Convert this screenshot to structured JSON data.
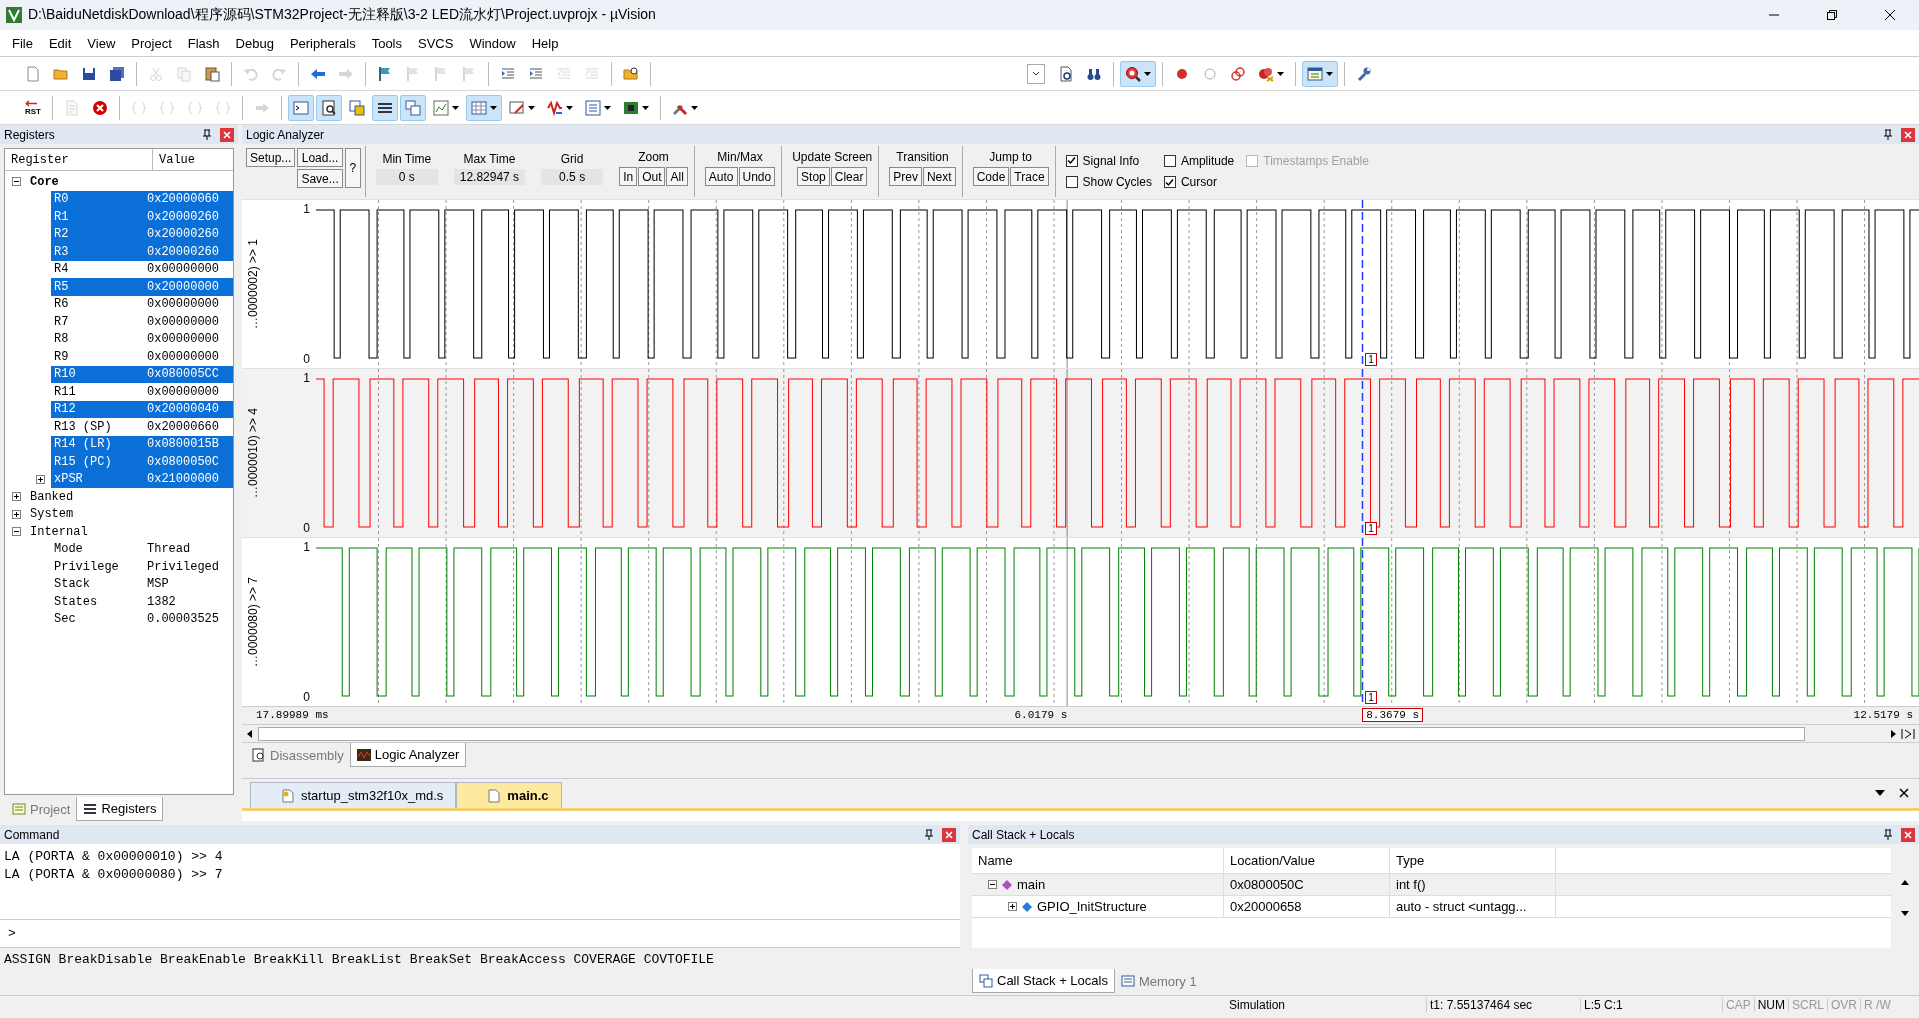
{
  "window": {
    "title": "D:\\BaiduNetdiskDownload\\程序源码\\STM32Project-无注释版\\3-2 LED流水灯\\Project.uvprojx - µVision"
  },
  "menu": [
    "File",
    "Edit",
    "View",
    "Project",
    "Flash",
    "Debug",
    "Peripherals",
    "Tools",
    "SVCS",
    "Window",
    "Help"
  ],
  "toolbars": [
    {
      "groups": [
        {
          "buttons": [
            {
              "kind": "new",
              "on": false,
              "disabled": false,
              "menu": false
            },
            {
              "kind": "open",
              "on": false,
              "disabled": false,
              "menu": false
            },
            {
              "kind": "save",
              "on": false,
              "disabled": false,
              "menu": false
            },
            {
              "kind": "saveall",
              "on": false,
              "disabled": false,
              "menu": false
            }
          ]
        },
        {
          "buttons": [
            {
              "kind": "cut",
              "on": false,
              "disabled": true,
              "menu": false
            },
            {
              "kind": "copy",
              "on": false,
              "disabled": true,
              "menu": false
            },
            {
              "kind": "paste",
              "on": false,
              "disabled": false,
              "menu": false
            }
          ]
        },
        {
          "buttons": [
            {
              "kind": "undo",
              "on": false,
              "disabled": true,
              "menu": false
            },
            {
              "kind": "redo",
              "on": false,
              "disabled": true,
              "menu": false
            }
          ]
        },
        {
          "buttons": [
            {
              "kind": "back",
              "on": false,
              "disabled": false,
              "menu": false
            },
            {
              "kind": "forward",
              "on": false,
              "disabled": true,
              "menu": false
            }
          ]
        },
        {
          "buttons": [
            {
              "kind": "flag",
              "on": false,
              "disabled": false,
              "menu": false
            },
            {
              "kind": "flag",
              "on": false,
              "disabled": true,
              "menu": false
            },
            {
              "kind": "flag",
              "on": false,
              "disabled": true,
              "menu": false
            },
            {
              "kind": "flag",
              "on": false,
              "disabled": true,
              "menu": false
            }
          ]
        },
        {
          "buttons": [
            {
              "kind": "indent",
              "on": false,
              "disabled": false,
              "menu": false
            },
            {
              "kind": "indent",
              "on": false,
              "disabled": false,
              "menu": false
            },
            {
              "kind": "comment",
              "on": false,
              "disabled": true,
              "menu": false
            },
            {
              "kind": "comment",
              "on": false,
              "disabled": true,
              "menu": false
            }
          ]
        },
        {
          "buttons": [
            {
              "kind": "findfiles",
              "on": false,
              "disabled": false,
              "menu": false
            }
          ]
        },
        {
          "buttons": [
            {
              "kind": "combo"
            },
            {
              "kind": "finddoc",
              "on": false,
              "disabled": false,
              "menu": false
            },
            {
              "kind": "binoculars",
              "on": false,
              "disabled": false,
              "menu": false
            }
          ]
        },
        {
          "buttons": [
            {
              "kind": "debug",
              "on": true,
              "disabled": false,
              "menu": true
            }
          ]
        },
        {
          "buttons": [
            {
              "kind": "breakpoint",
              "on": false,
              "disabled": false,
              "menu": false
            },
            {
              "kind": "circle",
              "on": false,
              "disabled": false,
              "menu": false
            },
            {
              "kind": "rings",
              "on": false,
              "disabled": false,
              "menu": false
            },
            {
              "kind": "killbp",
              "on": false,
              "disabled": false,
              "menu": true
            }
          ]
        },
        {
          "buttons": [
            {
              "kind": "window",
              "on": true,
              "disabled": false,
              "menu": true
            }
          ]
        },
        {
          "buttons": [
            {
              "kind": "wrench",
              "on": false,
              "disabled": false,
              "menu": false
            }
          ]
        }
      ]
    },
    {
      "groups": [
        {
          "buttons": [
            {
              "kind": "reset",
              "label": "RST",
              "on": false,
              "disabled": false,
              "menu": false
            }
          ]
        },
        {
          "buttons": [
            {
              "kind": "run",
              "on": false,
              "disabled": true,
              "menu": false
            },
            {
              "kind": "stop",
              "on": false,
              "disabled": false,
              "menu": false
            }
          ]
        },
        {
          "buttons": [
            {
              "kind": "braces",
              "on": false,
              "disabled": true,
              "menu": false
            },
            {
              "kind": "braces",
              "on": false,
              "disabled": true,
              "menu": false
            },
            {
              "kind": "braces",
              "on": false,
              "disabled": true,
              "menu": false
            },
            {
              "kind": "braces",
              "on": false,
              "disabled": true,
              "menu": false
            }
          ]
        },
        {
          "buttons": [
            {
              "kind": "arrow",
              "on": false,
              "disabled": true,
              "menu": false
            }
          ]
        },
        {
          "buttons": [
            {
              "kind": "command",
              "on": true,
              "disabled": false,
              "menu": false
            },
            {
              "kind": "disasm",
              "on": true,
              "disabled": false,
              "menu": false
            },
            {
              "kind": "symbols",
              "on": false,
              "disabled": false,
              "menu": false
            },
            {
              "kind": "registers",
              "on": true,
              "disabled": false,
              "menu": false
            },
            {
              "kind": "callstack",
              "on": true,
              "disabled": false,
              "menu": false
            },
            {
              "kind": "watch",
              "on": false,
              "disabled": false,
              "menu": true
            },
            {
              "kind": "grid",
              "on": true,
              "disabled": false,
              "menu": true
            },
            {
              "kind": "serial",
              "on": false,
              "disabled": false,
              "menu": true
            },
            {
              "kind": "analysis",
              "on": false,
              "disabled": false,
              "menu": true
            },
            {
              "kind": "trace",
              "on": false,
              "disabled": false,
              "menu": true
            },
            {
              "kind": "board",
              "on": false,
              "disabled": false,
              "menu": true
            }
          ]
        },
        {
          "buttons": [
            {
              "kind": "tools",
              "on": false,
              "disabled": false,
              "menu": true
            }
          ]
        }
      ]
    }
  ],
  "registers": {
    "title": "Registers",
    "columns": [
      "Register",
      "Value"
    ],
    "tree": [
      {
        "name": "Core",
        "bold": true,
        "expanded": true,
        "children": [
          {
            "name": "R0",
            "value": "0x20000060",
            "selected": true
          },
          {
            "name": "R1",
            "value": "0x20000260",
            "selected": true
          },
          {
            "name": "R2",
            "value": "0x20000260",
            "selected": true
          },
          {
            "name": "R3",
            "value": "0x20000260",
            "selected": true
          },
          {
            "name": "R4",
            "value": "0x00000000",
            "selected": false
          },
          {
            "name": "R5",
            "value": "0x20000000",
            "selected": true
          },
          {
            "name": "R6",
            "value": "0x00000000",
            "selected": false
          },
          {
            "name": "R7",
            "value": "0x00000000",
            "selected": false
          },
          {
            "name": "R8",
            "value": "0x00000000",
            "selected": false
          },
          {
            "name": "R9",
            "value": "0x00000000",
            "selected": false
          },
          {
            "name": "R10",
            "value": "0x080005CC",
            "selected": true
          },
          {
            "name": "R11",
            "value": "0x00000000",
            "selected": false
          },
          {
            "name": "R12",
            "value": "0x20000040",
            "selected": true
          },
          {
            "name": "R13 (SP)",
            "value": "0x20000660",
            "selected": false
          },
          {
            "name": "R14 (LR)",
            "value": "0x0800015B",
            "selected": true
          },
          {
            "name": "R15 (PC)",
            "value": "0x0800050C",
            "selected": true
          },
          {
            "name": "xPSR",
            "value": "0x21000000",
            "selected": true,
            "expanded": false
          }
        ]
      },
      {
        "name": "Banked",
        "bold": false,
        "expanded": false
      },
      {
        "name": "System",
        "bold": false,
        "expanded": false
      },
      {
        "name": "Internal",
        "bold": false,
        "expanded": true,
        "children": [
          {
            "name": "Mode",
            "value": "Thread",
            "selected": false
          },
          {
            "name": "Privilege",
            "value": "Privileged",
            "selected": false
          },
          {
            "name": "Stack",
            "value": "MSP",
            "selected": false
          },
          {
            "name": "States",
            "value": "1382",
            "selected": false
          },
          {
            "name": "Sec",
            "value": "0.00003525",
            "selected": false
          }
        ]
      }
    ],
    "tabs": [
      {
        "label": "Project",
        "selected": false
      },
      {
        "label": "Registers",
        "selected": true
      }
    ]
  },
  "logic_analyzer": {
    "title": "Logic Analyzer",
    "file_buttons": [
      "Setup...",
      "Load...",
      "Save..."
    ],
    "help_button": "?",
    "readouts": [
      {
        "label": "Min Time",
        "value": "0 s"
      },
      {
        "label": "Max Time",
        "value": "12.82947 s"
      },
      {
        "label": "Grid",
        "value": "0.5 s"
      }
    ],
    "groups": [
      {
        "label": "Zoom",
        "buttons": [
          "In",
          "Out",
          "All"
        ]
      },
      {
        "label": "Min/Max",
        "buttons": [
          "Auto",
          "Undo"
        ]
      },
      {
        "label": "Update Screen",
        "buttons": [
          "Stop",
          "Clear"
        ]
      },
      {
        "label": "Transition",
        "buttons": [
          "Prev",
          "Next"
        ]
      },
      {
        "label": "Jump to",
        "buttons": [
          "Code",
          "Trace"
        ]
      }
    ],
    "checkboxes": [
      {
        "label": "Signal Info",
        "checked": true,
        "disabled": false
      },
      {
        "label": "Show Cycles",
        "checked": false,
        "disabled": false
      },
      {
        "label": "Amplitude",
        "checked": false,
        "disabled": false
      },
      {
        "label": "Cursor",
        "checked": true,
        "disabled": false
      },
      {
        "label": "Timestamps Enable",
        "checked": false,
        "disabled": true
      }
    ],
    "signals": [
      {
        "label": "…0000002) >> 1",
        "color": "#000000",
        "high": "1",
        "low": "0",
        "marker": "1"
      },
      {
        "label": "…0000010) >> 4",
        "color": "#ff0000",
        "high": "1",
        "low": "0",
        "marker": "1"
      },
      {
        "label": "…0000080) >> 7",
        "color": "#008000",
        "high": "1",
        "low": "0",
        "marker": "1"
      }
    ],
    "axis": {
      "start": "17.89989 ms",
      "middle": "6.0179 s",
      "cursor": "8.3679 s",
      "end": "12.5179 s"
    },
    "tabs": [
      {
        "label": "Disassembly",
        "selected": false
      },
      {
        "label": "Logic Analyzer",
        "selected": true
      }
    ]
  },
  "editor_tabs": [
    {
      "label": "startup_stm32f10x_md.s",
      "selected": false
    },
    {
      "label": "main.c",
      "selected": true
    }
  ],
  "command": {
    "title": "Command",
    "lines": [
      "LA (PORTA & 0x00000010) >> 4",
      "LA (PORTA & 0x00000080) >> 7"
    ],
    "prompt": ">",
    "hint": "ASSIGN BreakDisable BreakEnable BreakKill BreakList BreakSet BreakAccess COVERAGE COVTOFILE"
  },
  "call_stack": {
    "title": "Call Stack + Locals",
    "columns": [
      "Name",
      "Location/Value",
      "Type"
    ],
    "rows": [
      {
        "name": "main",
        "value": "0x0800050C",
        "type": "int f()",
        "expanded": true,
        "children": [
          {
            "name": "GPIO_InitStructure",
            "value": "0x20000658",
            "type": "auto - struct <untagg...",
            "expanded": false
          }
        ]
      }
    ],
    "tabs": [
      {
        "label": "Call Stack + Locals",
        "selected": true
      },
      {
        "label": "Memory 1",
        "selected": false
      }
    ]
  },
  "status_bar": [
    {
      "text": "Simulation",
      "on": true
    },
    {
      "text": "t1: 7.55137464 sec",
      "on": true
    },
    {
      "text": "L:5 C:1",
      "on": true
    },
    {
      "text": "CAP",
      "on": false
    },
    {
      "text": "NUM",
      "on": true
    },
    {
      "text": "SCRL",
      "on": false
    },
    {
      "text": "OVR",
      "on": false
    },
    {
      "text": "R /W",
      "on": false
    }
  ]
}
